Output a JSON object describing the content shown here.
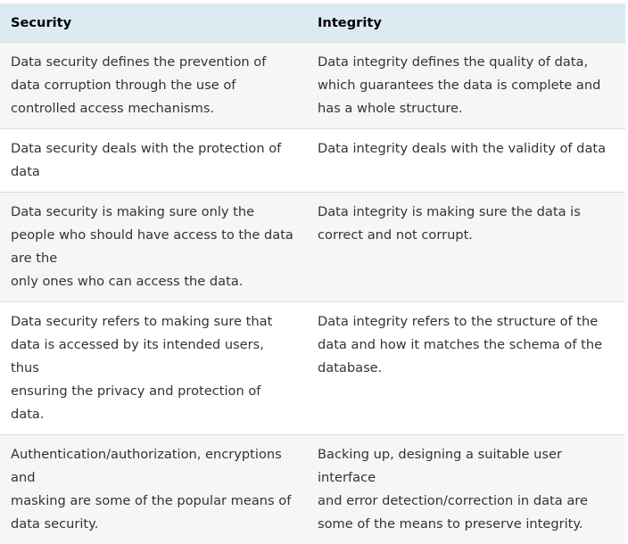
{
  "table": {
    "headers": [
      "Security",
      "Integrity"
    ],
    "rows": [
      {
        "security": "Data security defines the prevention of\ndata corruption through the use of\ncontrolled access mechanisms.",
        "integrity": "Data integrity defines the quality of data,\nwhich guarantees the data is complete and\nhas a whole structure."
      },
      {
        "security": "Data security deals with the protection of\ndata",
        "integrity": "Data integrity deals with the validity of data"
      },
      {
        "security": "Data security is making sure only the\npeople who should have access to the data\nare the\nonly ones who can access the data.",
        "integrity": "Data integrity is making sure the data is\ncorrect and not corrupt."
      },
      {
        "security": "Data security refers to making sure that\ndata is accessed by its intended users,\nthus\nensuring the privacy and protection of\ndata.",
        "integrity": "Data integrity refers to the structure of the\ndata and how it matches the schema of the\ndatabase."
      },
      {
        "security": "Authentication/authorization, encryptions\nand\nmasking are some of the popular means of\ndata security.",
        "integrity": "Backing up, designing a suitable user\ninterface\nand error detection/correction in data are\nsome of the means to preserve integrity."
      }
    ]
  }
}
